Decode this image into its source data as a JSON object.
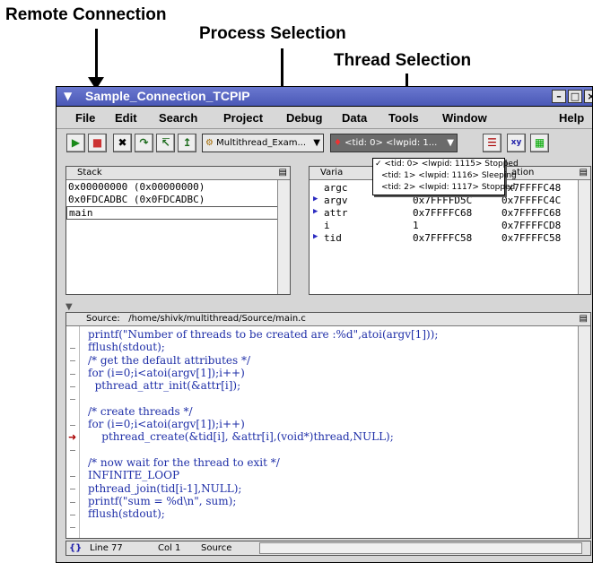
{
  "callouts": {
    "remote": "Remote Connection",
    "process": "Process Selection",
    "thread": "Thread Selection"
  },
  "window": {
    "title": "Sample_Connection_TCPIP"
  },
  "menu": [
    "File",
    "Edit",
    "Search",
    "Project",
    "Debug",
    "Data",
    "Tools",
    "Window",
    "Help"
  ],
  "toolbar": {
    "process_combo": "Multithread_Exam...",
    "thread_combo": "<tid: 0>  <lwpid: 1..."
  },
  "thread_menu": [
    "<tid: 0>  <lwpid: 1115> Stopped",
    "<tid: 1>  <lwpid: 1116> Sleeping",
    "<tid: 2>  <lwpid: 1117> Stopped"
  ],
  "stack": {
    "title": "Stack",
    "rows": [
      "0x00000000 (0x00000000)",
      "0x0FDCADBC (0x0FDCADBC)",
      "main"
    ]
  },
  "vars": {
    "title": "Varia",
    "loc_header": "ation",
    "rows": [
      {
        "name": "argc",
        "value": "",
        "location": "0x7FFFFC48"
      },
      {
        "name": "argv",
        "value": "0x7FFFFD5C",
        "location": "0x7FFFFC4C"
      },
      {
        "name": "attr",
        "value": "0x7FFFFC68",
        "location": "0x7FFFFC68"
      },
      {
        "name": "i",
        "value": "1",
        "location": "0x7FFFFCD8"
      },
      {
        "name": "tid",
        "value": "0x7FFFFC58",
        "location": "0x7FFFFC58"
      }
    ]
  },
  "source": {
    "label": "Source:",
    "path": "/home/shivk/multithread/Source/main.c",
    "lines": [
      "printf(\"Number of threads to be created are :%d\",atoi(argv[1]));",
      "fflush(stdout);",
      "/* get the default attributes */",
      "for (i=0;i<atoi(argv[1]);i++)",
      "  pthread_attr_init(&attr[i]);",
      "",
      "/* create threads */",
      "for (i=0;i<atoi(argv[1]);i++)",
      "    pthread_create(&tid[i], &attr[i],(void*)thread,NULL);",
      "",
      "/* now wait for the thread to exit */",
      "INFINITE_LOOP",
      "pthread_join(tid[i-1],NULL);",
      "printf(\"sum = %d\\n\", sum);",
      "fflush(stdout);"
    ]
  },
  "status": {
    "line": "Line 77",
    "col": "Col 1",
    "mode": "Source"
  }
}
